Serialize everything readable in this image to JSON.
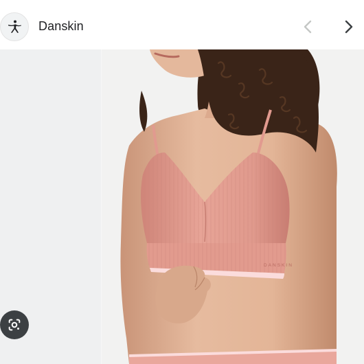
{
  "header": {
    "brand_name": "Danskin",
    "logo_icon": "danskin-dancer-logo",
    "prev_icon": "chevron-left-icon",
    "next_icon": "chevron-right-icon"
  },
  "image": {
    "subject": "product-photo",
    "imprint_text": "DANSKIN",
    "colors": {
      "background": "#eff0f1",
      "top_fabric": "#e19a8f",
      "trim": "#fbdcdc",
      "skin": "#e2b59a",
      "hair": "#3a2418"
    }
  },
  "controls": {
    "lens_icon": "google-lens-icon"
  }
}
